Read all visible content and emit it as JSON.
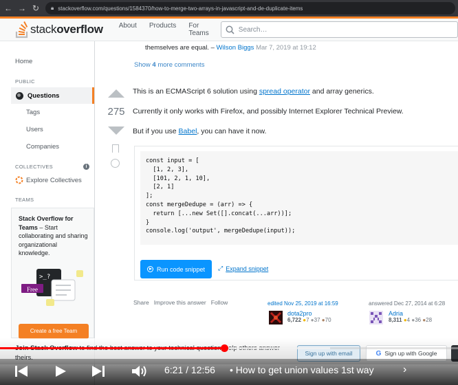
{
  "browser": {
    "url": "stackoverflow.com/questions/1584370/how-to-merge-two-arrays-in-javascript-and-de-duplicate-items"
  },
  "topbar": {
    "logo_plain": "stack",
    "logo_bold": "overflow",
    "nav": [
      "About",
      "Products",
      "For Teams"
    ],
    "search_placeholder": "Search…"
  },
  "sidebar": {
    "home": "Home",
    "public_heading": "PUBLIC",
    "questions": "Questions",
    "tags": "Tags",
    "users": "Users",
    "companies": "Companies",
    "collectives_heading": "COLLECTIVES",
    "explore_collectives": "Explore Collectives",
    "teams_heading": "TEAMS",
    "teams_title": "Stack Overflow for Teams",
    "teams_desc": " – Start collaborating and sharing organizational knowledge.",
    "teams_badge": "Free",
    "teams_button": "Create a free Team"
  },
  "comment": {
    "text": "themselves are equal. –",
    "user": "Wilson Biggs",
    "date": "Mar 7, 2019 at 19:12"
  },
  "show_more": {
    "prefix": "Show ",
    "count": "4",
    "suffix": " more comments"
  },
  "answer": {
    "score": "275",
    "p1_before": "This is an ECMAScript 6 solution using ",
    "p1_link": "spread operator",
    "p1_after": " and array generics.",
    "p2": "Currently it only works with Firefox, and possibly Internet Explorer Technical Preview.",
    "p3_before": "But if you use ",
    "p3_link": "Babel",
    "p3_after": ", you can have it now.",
    "code": [
      "const input = [",
      "  [1, 2, 3],",
      "  [101, 2, 1, 10],",
      "  [2, 1]",
      "];",
      "const mergeDedupe = (arr) => {",
      "  return [...new Set([].concat(...arr))];",
      "}",
      "",
      "console.log('output', mergeDedupe(input));"
    ],
    "run_button": "Run code snippet",
    "expand_link": "Expand snippet",
    "menu": [
      "Share",
      "Improve this answer",
      "Follow"
    ],
    "edited": {
      "when": "edited Nov 25, 2019 at 16:59",
      "user": "dota2pro",
      "rep": "6,722",
      "gold": "7",
      "silver": "37",
      "bronze": "70"
    },
    "answered": {
      "when": "answered Dec 27, 2014 at 6:28",
      "user": "Adria",
      "rep": "8,311",
      "gold": "4",
      "silver": "36",
      "bronze": "28"
    }
  },
  "banner": {
    "bold": "Join Stack Overflow",
    "text": " to find the best answer to your technical question, help others answer theirs.",
    "signup_email": "Sign up with email",
    "signup_google": "Sign up with Google"
  },
  "video": {
    "current_time": "6:21",
    "separator": " / ",
    "duration": "12:56",
    "title": "• How to get union values 1st way",
    "progress": 0.49,
    "buffered": 0.72
  },
  "colors": {
    "accent": "#f48024",
    "link": "#0074cc",
    "button": "#0a95ff",
    "progress": "#ff0000"
  }
}
